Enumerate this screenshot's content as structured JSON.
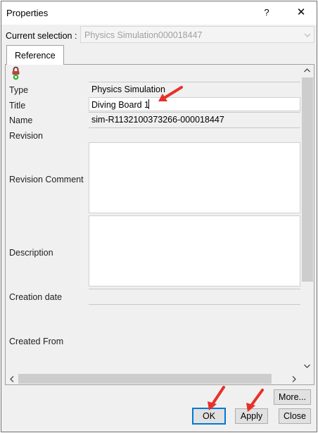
{
  "dialog": {
    "title": "Properties",
    "help_label": "?",
    "close_label": "✕"
  },
  "current_selection": {
    "label": "Current selection :",
    "value": "Physics Simulation000018447"
  },
  "tabs": [
    {
      "label": "Reference",
      "selected": true
    }
  ],
  "fields": {
    "type": {
      "label": "Type",
      "value": "Physics Simulation"
    },
    "title": {
      "label": "Title",
      "value": "Diving Board 1"
    },
    "name": {
      "label": "Name",
      "value": "sim-R1132100373266-000018447"
    },
    "revision": {
      "label": "Revision",
      "value": ""
    },
    "revision_comment": {
      "label": "Revision Comment",
      "value": ""
    },
    "description": {
      "label": "Description",
      "value": ""
    },
    "creation_date": {
      "label": "Creation date",
      "value": ""
    },
    "created_from": {
      "label": "Created From",
      "value": ""
    }
  },
  "buttons": {
    "more": "More...",
    "ok": "OK",
    "apply": "Apply",
    "close": "Close"
  },
  "icons": {
    "lock": "lock-icon",
    "annotation_arrows": "red-arrow-icon"
  },
  "colors": {
    "annotation_arrow": "#e8302a",
    "default_button_border": "#0078d7",
    "lock_green": "#2fae2f"
  }
}
